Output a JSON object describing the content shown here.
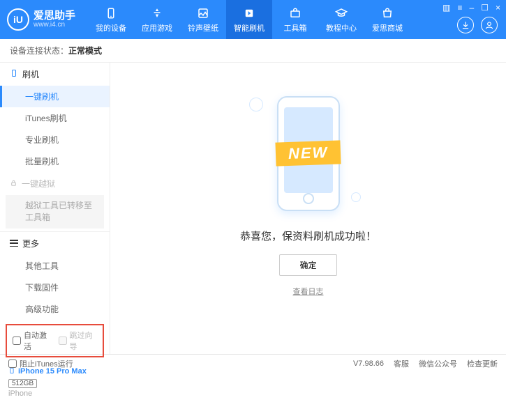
{
  "header": {
    "app_name": "爱思助手",
    "app_url": "www.i4.cn",
    "logo_letter": "iU",
    "nav": [
      {
        "label": "我的设备"
      },
      {
        "label": "应用游戏"
      },
      {
        "label": "铃声壁纸"
      },
      {
        "label": "智能刷机"
      },
      {
        "label": "工具箱"
      },
      {
        "label": "教程中心"
      },
      {
        "label": "爱思商城"
      }
    ]
  },
  "status": {
    "label": "设备连接状态：",
    "value": "正常模式"
  },
  "sidebar": {
    "flash_header": "刷机",
    "flash_items": [
      "一键刷机",
      "iTunes刷机",
      "专业刷机",
      "批量刷机"
    ],
    "jailbreak_header": "一键越狱",
    "jailbreak_note": "越狱工具已转移至工具箱",
    "more_header": "更多",
    "more_items": [
      "其他工具",
      "下载固件",
      "高级功能"
    ],
    "checkbox1": "自动激活",
    "checkbox2": "跳过向导",
    "device_name": "iPhone 15 Pro Max",
    "device_storage": "512GB",
    "device_type": "iPhone"
  },
  "main": {
    "ribbon_text": "NEW",
    "success_message": "恭喜您，保资料刷机成功啦！",
    "confirm_button": "确定",
    "view_log": "查看日志"
  },
  "footer": {
    "block_itunes": "阻止iTunes运行",
    "version": "V7.98.66",
    "links": [
      "客服",
      "微信公众号",
      "检查更新"
    ]
  }
}
